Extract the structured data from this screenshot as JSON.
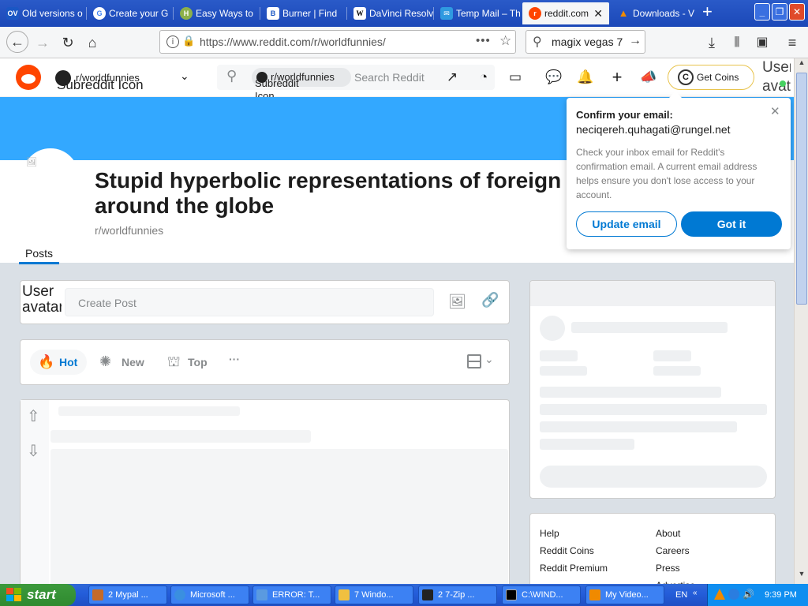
{
  "browser": {
    "tabs": [
      {
        "label": "Old versions o",
        "icon": "ov-icon",
        "icon_text": "OV",
        "color": "#1a57c4"
      },
      {
        "label": "Create your G",
        "icon": "google-icon",
        "icon_text": "G",
        "color": "#ffffff"
      },
      {
        "label": "Easy Ways to",
        "icon": "wikihow-icon",
        "icon_text": "H",
        "color": "#8cb04a"
      },
      {
        "label": "Burner | Find",
        "icon": "burner-icon",
        "icon_text": "B",
        "color": "#ffffff"
      },
      {
        "label": "DaVinci Resolv",
        "icon": "wikipedia-icon",
        "icon_text": "W",
        "color": "#ffffff"
      },
      {
        "label": "Temp Mail – Th",
        "icon": "tempmail-icon",
        "icon_text": "T",
        "color": "#2f9ae0"
      },
      {
        "label": "reddit.com",
        "icon": "reddit-icon",
        "icon_text": "r",
        "color": "#ff4500"
      },
      {
        "label": "Downloads - V",
        "icon": "vlc-icon",
        "icon_text": "▲",
        "color": "#f08a00"
      }
    ],
    "url": "https://www.reddit.com/r/worldfunnies/",
    "search_value": "magix vegas 7"
  },
  "reddit": {
    "community_icon_alt": "Subreddit Icon",
    "community_name": "r/worldfunnies",
    "search_chip_icon_alt": "Subreddit Icon",
    "search_chip": "r/worldfunnies",
    "search_placeholder": "Search Reddit",
    "get_coins": "Get Coins",
    "user_avatar_alt": "User avatar",
    "subreddit_title": "Stupid hyperbolic representations of foreign v around the globe",
    "subreddit_name": "r/worldfunnies",
    "posts_tab": "Posts",
    "create_post_avatar_alt": "User avatar",
    "create_post_placeholder": "Create Post",
    "sort": {
      "hot": "Hot",
      "new": "New",
      "top": "Top",
      "more": "···"
    },
    "footer_links": {
      "col1": [
        "Help",
        "Reddit Coins",
        "Reddit Premium"
      ],
      "col2": [
        "About",
        "Careers",
        "Press",
        "Advertise"
      ]
    }
  },
  "popup": {
    "title": "Confirm your email:",
    "email": "neciqereh.quhagati@rungel.net",
    "body": "Check your inbox email for Reddit's confirmation email. A current email address helps ensure you don't lose access to your account.",
    "update_button": "Update email",
    "got_it_button": "Got it"
  },
  "taskbar": {
    "start": "start",
    "tasks": [
      "2 Mypal ...",
      "Microsoft ...",
      "ERROR: T...",
      "7 Windo...",
      "2 7-Zip ...",
      "C:\\WIND...",
      "My Video..."
    ],
    "language": "EN",
    "clock": "9:39 PM"
  },
  "colors": {
    "reddit_orange": "#ff4500",
    "banner_blue": "#33a8ff",
    "button_blue": "#0079d3"
  }
}
